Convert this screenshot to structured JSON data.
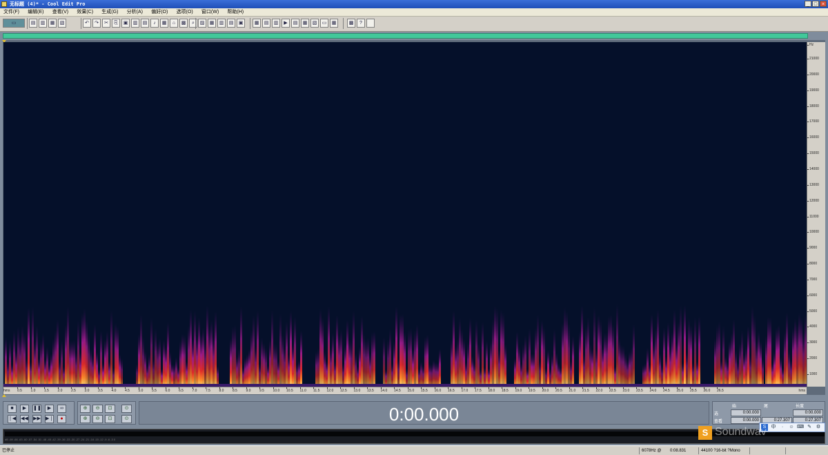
{
  "window": {
    "title": "无标题 (4)* - Cool Edit Pro",
    "minimize": "_",
    "maximize": "□",
    "close": "×"
  },
  "menu": [
    "文件(F)",
    "编辑(E)",
    "查看(V)",
    "效果(C)",
    "生成(G)",
    "分析(A)",
    "偏好(O)",
    "选项(O)",
    "窗口(W)",
    "帮助(H)"
  ],
  "toolbar_glyphs": [
    "▭",
    "▤",
    "▥",
    "▦",
    "▧",
    "↶",
    "↷",
    "✂",
    "⎘",
    "▣",
    "▥",
    "▤",
    "♪",
    "▦",
    "⌂",
    "▩",
    "⌕",
    "▨",
    "▦",
    "▥",
    "▤",
    "▣",
    "▦",
    "▤",
    "▥",
    "▶",
    "▤",
    "▦",
    "▧",
    "▭",
    "▦",
    "▩",
    "?"
  ],
  "spectrogram": {
    "freq_unit": "Hz",
    "freq_ticks": [
      "21000",
      "20000",
      "19000",
      "18000",
      "17000",
      "16000",
      "15000",
      "14000",
      "13000",
      "12000",
      "11000",
      "10000",
      "9000",
      "8000",
      "7000",
      "6000",
      "5000",
      "4000",
      "3000",
      "2000",
      "1000"
    ],
    "time_unit": "hms",
    "time_ticks": [
      "0.5",
      "1.0",
      "1.5",
      "2.0",
      "2.5",
      "3.0",
      "3.5",
      "4.0",
      "4.5",
      "5.0",
      "5.5",
      "6.0",
      "6.5",
      "7.0",
      "7.5",
      "8.0",
      "8.5",
      "9.0",
      "9.5",
      "10.0",
      "10.5",
      "11.0",
      "11.5",
      "12.0",
      "12.5",
      "13.0",
      "13.5",
      "14.0",
      "14.5",
      "15.0",
      "15.5",
      "16.0",
      "16.5",
      "17.0",
      "17.5",
      "18.0",
      "18.5",
      "19.0",
      "19.5",
      "20.0",
      "20.5",
      "21.0",
      "21.5",
      "22.0",
      "22.5",
      "23.0",
      "23.5",
      "24.0",
      "24.5",
      "25.0",
      "25.5",
      "26.0",
      "26.5"
    ]
  },
  "transport": {
    "stop": "■",
    "play": "▶",
    "pause": "❚❚",
    "play_to_end": "▶",
    "loop": "∞",
    "go_start": "❘◀",
    "rewind": "◀◀",
    "forward": "▶▶",
    "go_end": "▶❘",
    "record": "●"
  },
  "zoom": [
    "⊕",
    "⊖",
    "⊡",
    "⊙",
    "⊕",
    "⊖",
    "⊡",
    "⊙"
  ],
  "time_display": "0:00.000",
  "selection": {
    "header_begin": "始",
    "header_end": "尾",
    "header_length": "长度",
    "row_sel": "选",
    "row_view": "查看",
    "sel_begin": "0:00.000",
    "sel_length": "0:00.000",
    "view_begin": "0:00.000",
    "view_end": "0:27.307",
    "view_length": "0:27.307"
  },
  "level_scale": "dB -69 -66 -63 -60 -57 -54 -51 -48 -45 -42 -39 -36 -33 -30 -27 -24 -21 -18 -15 -12 -9 -6 -3 0",
  "watermark": {
    "icon": "S",
    "text": "Soundwav"
  },
  "ime": [
    "S",
    "中",
    "·",
    "☺",
    "⌨",
    "✎",
    "⚙"
  ],
  "status": {
    "state": "已停止",
    "freq_readout": "6078Hz @",
    "time_readout": "0:08.831",
    "format": "44100 ?16-bit ?Mono",
    "size": "",
    "free": ""
  },
  "colors": {
    "background": "#05102a",
    "hot": "#ffe070",
    "warm": "#f0401a",
    "cool": "#9a1a9a"
  }
}
